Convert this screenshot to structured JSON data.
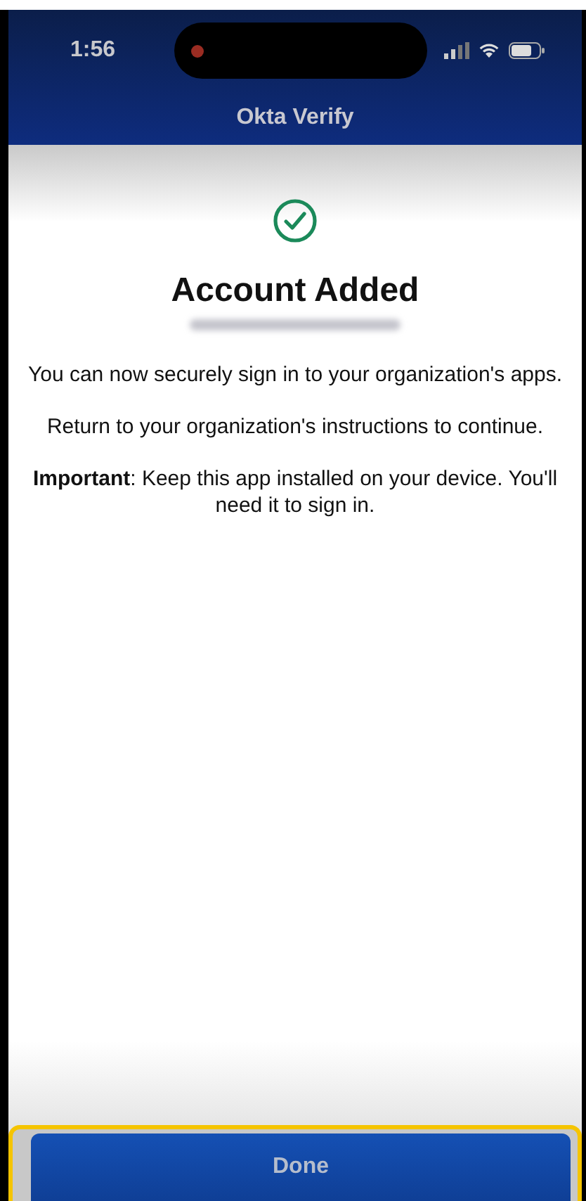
{
  "status_bar": {
    "time": "1:56",
    "recording": true
  },
  "header": {
    "title": "Okta Verify"
  },
  "result": {
    "title": "Account Added",
    "email_redacted": true,
    "paragraphs": [
      "You can now securely sign in to your organization's apps.",
      "Return to your organization's instructions to continue.",
      "**Important**: Keep this app installed on your device. You'll need it to sign in."
    ]
  },
  "button": {
    "label": "Done",
    "highlighted": true
  }
}
